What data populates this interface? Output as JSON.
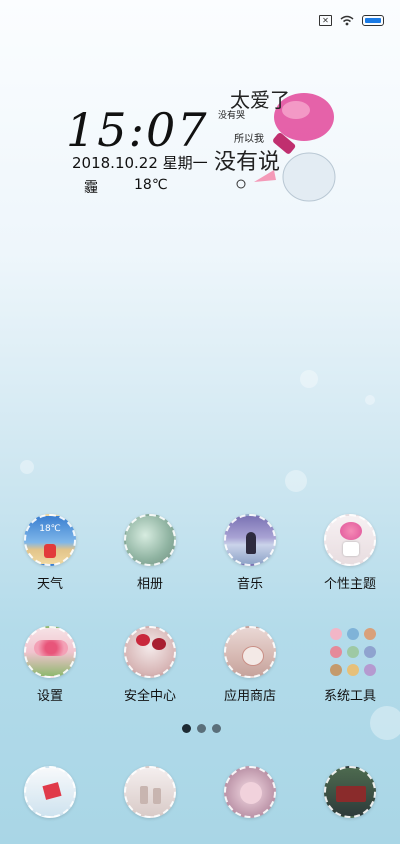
{
  "status": {
    "icons": [
      "sim-slash-icon",
      "wifi-icon",
      "battery-icon"
    ]
  },
  "lockwidget": {
    "time": "15:07",
    "date_line": "2018.10.22  星期一",
    "weather_condition": "霾",
    "temperature": "18℃"
  },
  "art": {
    "big_chars": "太爱了",
    "small_chars_1": "所以我",
    "small_chars_2": "没有",
    "big_chars_2": "没有说",
    "small_chars_3": "没有哭"
  },
  "apps_row1": [
    {
      "label": "天气",
      "icon": "weather-icon",
      "badge": "18℃"
    },
    {
      "label": "相册",
      "icon": "gallery-icon"
    },
    {
      "label": "音乐",
      "icon": "music-icon"
    },
    {
      "label": "个性主题",
      "icon": "theme-icon"
    }
  ],
  "apps_row2": [
    {
      "label": "设置",
      "icon": "settings-icon"
    },
    {
      "label": "安全中心",
      "icon": "security-icon"
    },
    {
      "label": "应用商店",
      "icon": "app-store-icon"
    },
    {
      "label": "系统工具",
      "icon": "system-tools-folder-icon"
    }
  ],
  "dock": [
    {
      "icon": "phone-icon"
    },
    {
      "icon": "messages-icon"
    },
    {
      "icon": "browser-icon"
    },
    {
      "icon": "camera-icon"
    }
  ],
  "page_indicator": {
    "pages": 3,
    "current": 1
  }
}
